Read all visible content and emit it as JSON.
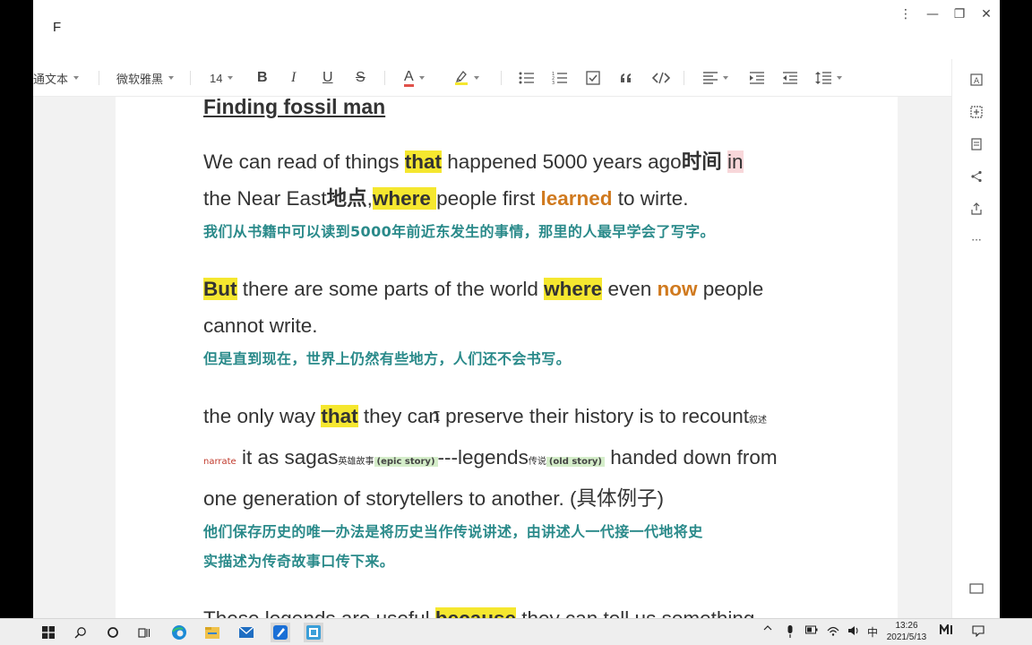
{
  "window": {
    "title": "F",
    "controls": {
      "more": "⋮",
      "minimize": "—",
      "restore": "❐",
      "close": "✕"
    }
  },
  "toolbar": {
    "paragraph_style": "通文本",
    "font_family": "微软雅黑",
    "font_size": "14",
    "buttons": [
      "bold",
      "italic",
      "underline",
      "strikethrough",
      "font-color",
      "highlight",
      "bullet-list",
      "numbered-list",
      "checklist",
      "quote",
      "code",
      "align",
      "indent",
      "outdent",
      "line-height"
    ],
    "bold_label": "B",
    "italic_label": "I",
    "underline_label": "U",
    "strike_label": "S",
    "font_color_label": "A",
    "font_color": "#e0524a",
    "highlight_color": "#f5e72f"
  },
  "document": {
    "title": "Finding fossil man",
    "p1": {
      "s1": "We can read of things ",
      "h1": "that",
      "s2": " happened 5000 years ago",
      "b1": "时间",
      "s3": " ",
      "pink": "in",
      "s4": "the Near East",
      "b2": "地点",
      "s5": ",",
      "h2": "where ",
      "s6": "people first ",
      "o1": "learned",
      "s7": " to wirte.",
      "zh": "我们从书籍中可以读到5000年前近东发生的事情，那里的人最早学会了写字。"
    },
    "p2": {
      "h1": "But",
      "s1": " there are some parts of the world ",
      "h2": "where",
      "s2": " even ",
      "o1": "now",
      "s3": " people",
      "s4": "cannot write.",
      "zh": "但是直到现在，世界上仍然有些地方，人们还不会书写。"
    },
    "p3": {
      "s1": "the only way ",
      "h1": "that",
      "s2": " they can preserve their history is to recount",
      "a1": "叙述",
      "r1": "narrate",
      "s3": " it as sagas",
      "a2": "英雄故事",
      "g1": "(epic story)",
      "s4": "---legends",
      "a3": "传说",
      "g2": "(old story)",
      "s5": " handed down from",
      "s6": "one generation of storytellers to another. (具体例子)",
      "zh1": "他们保存历史的唯一办法是将历史当作传说讲述，由讲述人一代接一代地将史",
      "zh2": "实描述为传奇故事口传下来。"
    },
    "p4": {
      "s1": "These legends are useful ",
      "h1": "because",
      "s2": " they can tell us something"
    }
  },
  "right_panel": [
    "outline-icon",
    "add-block-icon",
    "document-icon",
    "share-icon",
    "export-icon",
    "more-icon",
    "comment-box-icon"
  ],
  "right_panel_more": "···",
  "taskbar": {
    "ime": "中",
    "time": "13:26",
    "date": "2021/5/13"
  }
}
